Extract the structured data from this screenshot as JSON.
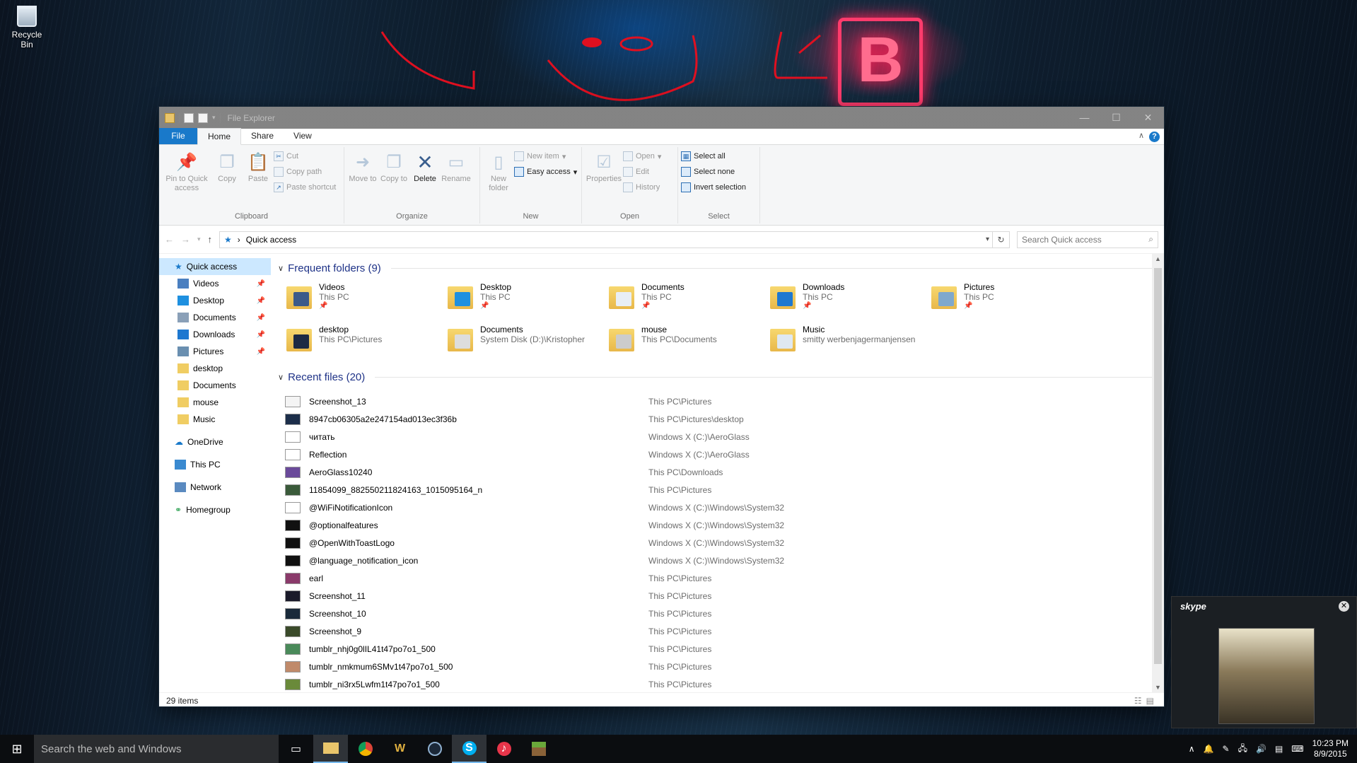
{
  "desktop": {
    "recycle_bin": "Recycle Bin",
    "neon_letter": "B"
  },
  "window": {
    "title": "File Explorer",
    "controls": {
      "minimize": "—",
      "maximize": "☐",
      "close": "✕"
    }
  },
  "ribbon_tabs": {
    "file": "File",
    "home": "Home",
    "share": "Share",
    "view": "View",
    "help": "?"
  },
  "ribbon": {
    "clipboard": {
      "name": "Clipboard",
      "pin": "Pin to Quick access",
      "copy": "Copy",
      "paste": "Paste",
      "cut": "Cut",
      "copy_path": "Copy path",
      "paste_shortcut": "Paste shortcut"
    },
    "organize": {
      "name": "Organize",
      "move_to": "Move to",
      "copy_to": "Copy to",
      "delete": "Delete",
      "rename": "Rename"
    },
    "new": {
      "name": "New",
      "new_folder": "New folder",
      "new_item": "New item",
      "easy_access": "Easy access"
    },
    "open": {
      "name": "Open",
      "properties": "Properties",
      "open": "Open",
      "edit": "Edit",
      "history": "History"
    },
    "select": {
      "name": "Select",
      "select_all": "Select all",
      "select_none": "Select none",
      "invert": "Invert selection"
    }
  },
  "address": {
    "path": "Quick access",
    "search_placeholder": "Search Quick access"
  },
  "nav": {
    "quick_access": "Quick access",
    "items": [
      {
        "label": "Videos",
        "pinned": true,
        "color": "#4a7fc0"
      },
      {
        "label": "Desktop",
        "pinned": true,
        "color": "#1e90e0"
      },
      {
        "label": "Documents",
        "pinned": true,
        "color": "#8aa0b8"
      },
      {
        "label": "Downloads",
        "pinned": true,
        "color": "#1e78d0"
      },
      {
        "label": "Pictures",
        "pinned": true,
        "color": "#6a8fb0"
      },
      {
        "label": "desktop",
        "pinned": false,
        "color": "#f0cd63"
      },
      {
        "label": "Documents",
        "pinned": false,
        "color": "#f0cd63"
      },
      {
        "label": "mouse",
        "pinned": false,
        "color": "#f0cd63"
      },
      {
        "label": "Music",
        "pinned": false,
        "color": "#f0cd63"
      }
    ],
    "onedrive": "OneDrive",
    "this_pc": "This PC",
    "network": "Network",
    "homegroup": "Homegroup"
  },
  "frequent": {
    "header": "Frequent folders (9)",
    "folders": [
      {
        "name": "Videos",
        "sub": "This PC",
        "pinned": true,
        "overlay": "#3b5a8a"
      },
      {
        "name": "Desktop",
        "sub": "This PC",
        "pinned": true,
        "overlay": "#1e90e0"
      },
      {
        "name": "Documents",
        "sub": "This PC",
        "pinned": true,
        "overlay": "#e8eef5"
      },
      {
        "name": "Downloads",
        "sub": "This PC",
        "pinned": true,
        "overlay": "#1e78d0"
      },
      {
        "name": "Pictures",
        "sub": "This PC",
        "pinned": true,
        "overlay": "#7fa8cc"
      },
      {
        "name": "desktop",
        "sub": "This PC\\Pictures",
        "pinned": false,
        "overlay": "#1d2a44"
      },
      {
        "name": "Documents",
        "sub": "System Disk (D:)\\Kristopher",
        "pinned": false,
        "overlay": "#ddd"
      },
      {
        "name": "mouse",
        "sub": "This PC\\Documents",
        "pinned": false,
        "overlay": "#ccc"
      },
      {
        "name": "Music",
        "sub": "smitty werbenjagermanjensen",
        "pinned": false,
        "overlay": "#dfe8f0"
      }
    ]
  },
  "recent": {
    "header": "Recent files (20)",
    "files": [
      {
        "name": "Screenshot_13",
        "path": "This PC\\Pictures",
        "thumb": "#f4f4f4"
      },
      {
        "name": "8947cb06305a2e247154ad013ec3f36b",
        "path": "This PC\\Pictures\\desktop",
        "thumb": "#1c2e4a"
      },
      {
        "name": "читать",
        "path": "Windows X (C:)\\AeroGlass",
        "thumb": "#ffffff"
      },
      {
        "name": "Reflection",
        "path": "Windows X (C:)\\AeroGlass",
        "thumb": "#ffffff"
      },
      {
        "name": "AeroGlass10240",
        "path": "This PC\\Downloads",
        "thumb": "#6a4a9a"
      },
      {
        "name": "11854099_882550211824163_1015095164_n",
        "path": "This PC\\Pictures",
        "thumb": "#3a5a3a"
      },
      {
        "name": "@WiFiNotificationIcon",
        "path": "Windows X (C:)\\Windows\\System32",
        "thumb": "#ffffff"
      },
      {
        "name": "@optionalfeatures",
        "path": "Windows X (C:)\\Windows\\System32",
        "thumb": "#111111"
      },
      {
        "name": "@OpenWithToastLogo",
        "path": "Windows X (C:)\\Windows\\System32",
        "thumb": "#111111"
      },
      {
        "name": "@language_notification_icon",
        "path": "Windows X (C:)\\Windows\\System32",
        "thumb": "#111111"
      },
      {
        "name": "earl",
        "path": "This PC\\Pictures",
        "thumb": "#8a3a6a"
      },
      {
        "name": "Screenshot_11",
        "path": "This PC\\Pictures",
        "thumb": "#1a1a2a"
      },
      {
        "name": "Screenshot_10",
        "path": "This PC\\Pictures",
        "thumb": "#1a2a3a"
      },
      {
        "name": "Screenshot_9",
        "path": "This PC\\Pictures",
        "thumb": "#3a4a2a"
      },
      {
        "name": "tumblr_nhj0g0lIL41t47po7o1_500",
        "path": "This PC\\Pictures",
        "thumb": "#4a8a5a"
      },
      {
        "name": "tumblr_nmkmum6SMv1t47po7o1_500",
        "path": "This PC\\Pictures",
        "thumb": "#c08a6a"
      },
      {
        "name": "tumblr_ni3rx5Lwfm1t47po7o1_500",
        "path": "This PC\\Pictures",
        "thumb": "#6a8a3a"
      }
    ]
  },
  "status": {
    "items": "29 items"
  },
  "skype": {
    "brand": "skype",
    "close": "✕"
  },
  "taskbar": {
    "search_placeholder": "Search the web and Windows",
    "apps": [
      "task-view",
      "file-explorer",
      "chrome",
      "wow",
      "steam",
      "skype",
      "itunes",
      "minecraft"
    ],
    "time": "10:23 PM",
    "date": "8/9/2015"
  }
}
